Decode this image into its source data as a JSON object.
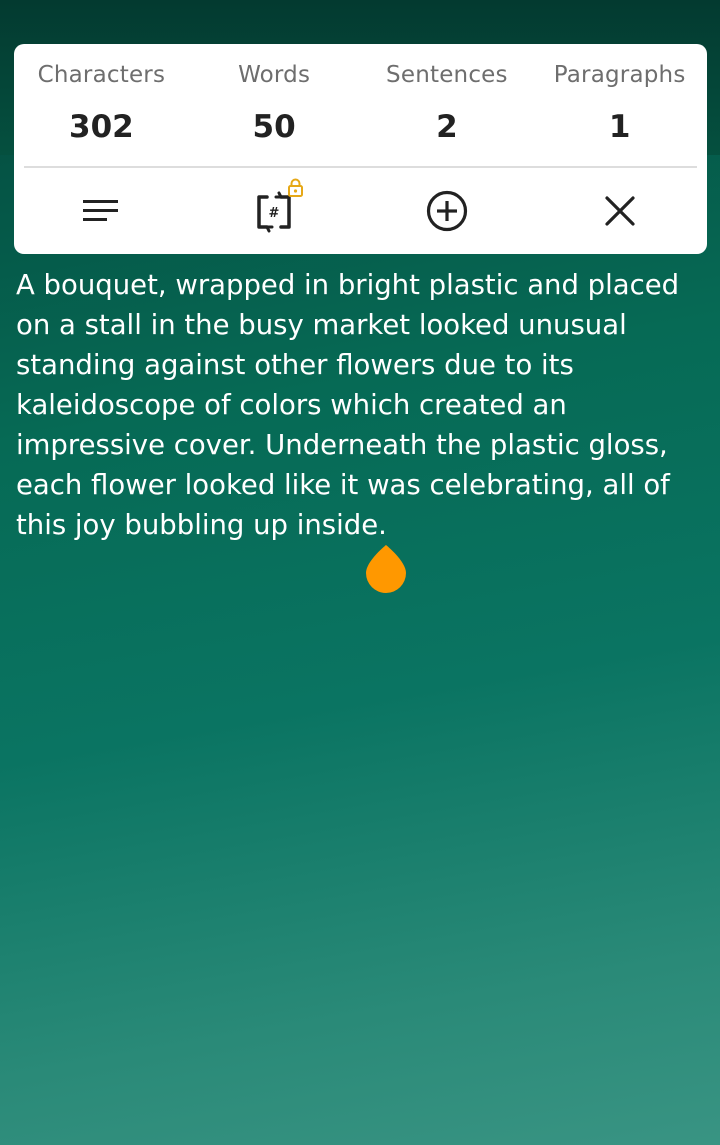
{
  "stats": {
    "characters_label": "Characters",
    "characters_value": "302",
    "words_label": "Words",
    "words_value": "50",
    "sentences_label": "Sentences",
    "sentences_value": "2",
    "paragraphs_label": "Paragraphs",
    "paragraphs_value": "1"
  },
  "actions": [
    {
      "icon": "text-align-icon"
    },
    {
      "icon": "text-count-icon",
      "locked": true
    },
    {
      "icon": "add-circle-icon"
    },
    {
      "icon": "close-icon"
    }
  ],
  "editor": {
    "text": "A bouquet, wrapped in bright plastic and placed on a stall in the busy market looked unusual standing against other flowers due to its kaleidoscope of colors which created an impressive cover. Underneath the plastic gloss, each flower looked like it was celebrating, all of this joy bubbling up inside."
  },
  "colors": {
    "accent": "#ff9800",
    "lock": "#e6a817",
    "card_bg": "#ffffff",
    "text": "#ffffff"
  }
}
